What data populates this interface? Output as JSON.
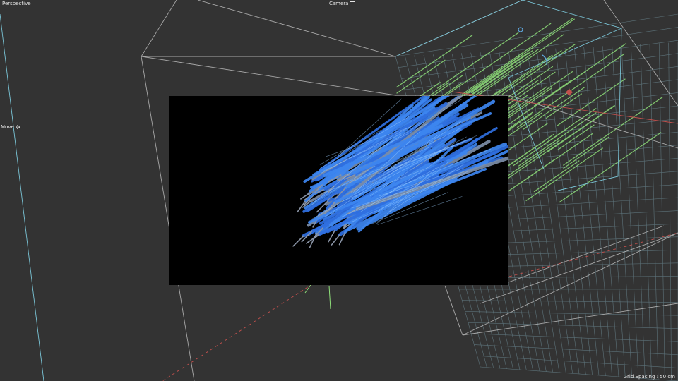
{
  "viewport": {
    "view_name": "Perspective",
    "camera_name": "Camera",
    "tool_name": "Move",
    "grid_spacing": "Grid Spacing : 50 cm"
  },
  "icons": {
    "camera": "camera-icon",
    "move": "move-icon"
  },
  "colors": {
    "background": "#333333",
    "grid": "#7fa7b4",
    "edges": "#c8c8c8",
    "hair_guides": "#8fe07a",
    "axis_x": "#c0504d",
    "hair_render": "#2f6fe0",
    "render_bg": "#000000"
  }
}
